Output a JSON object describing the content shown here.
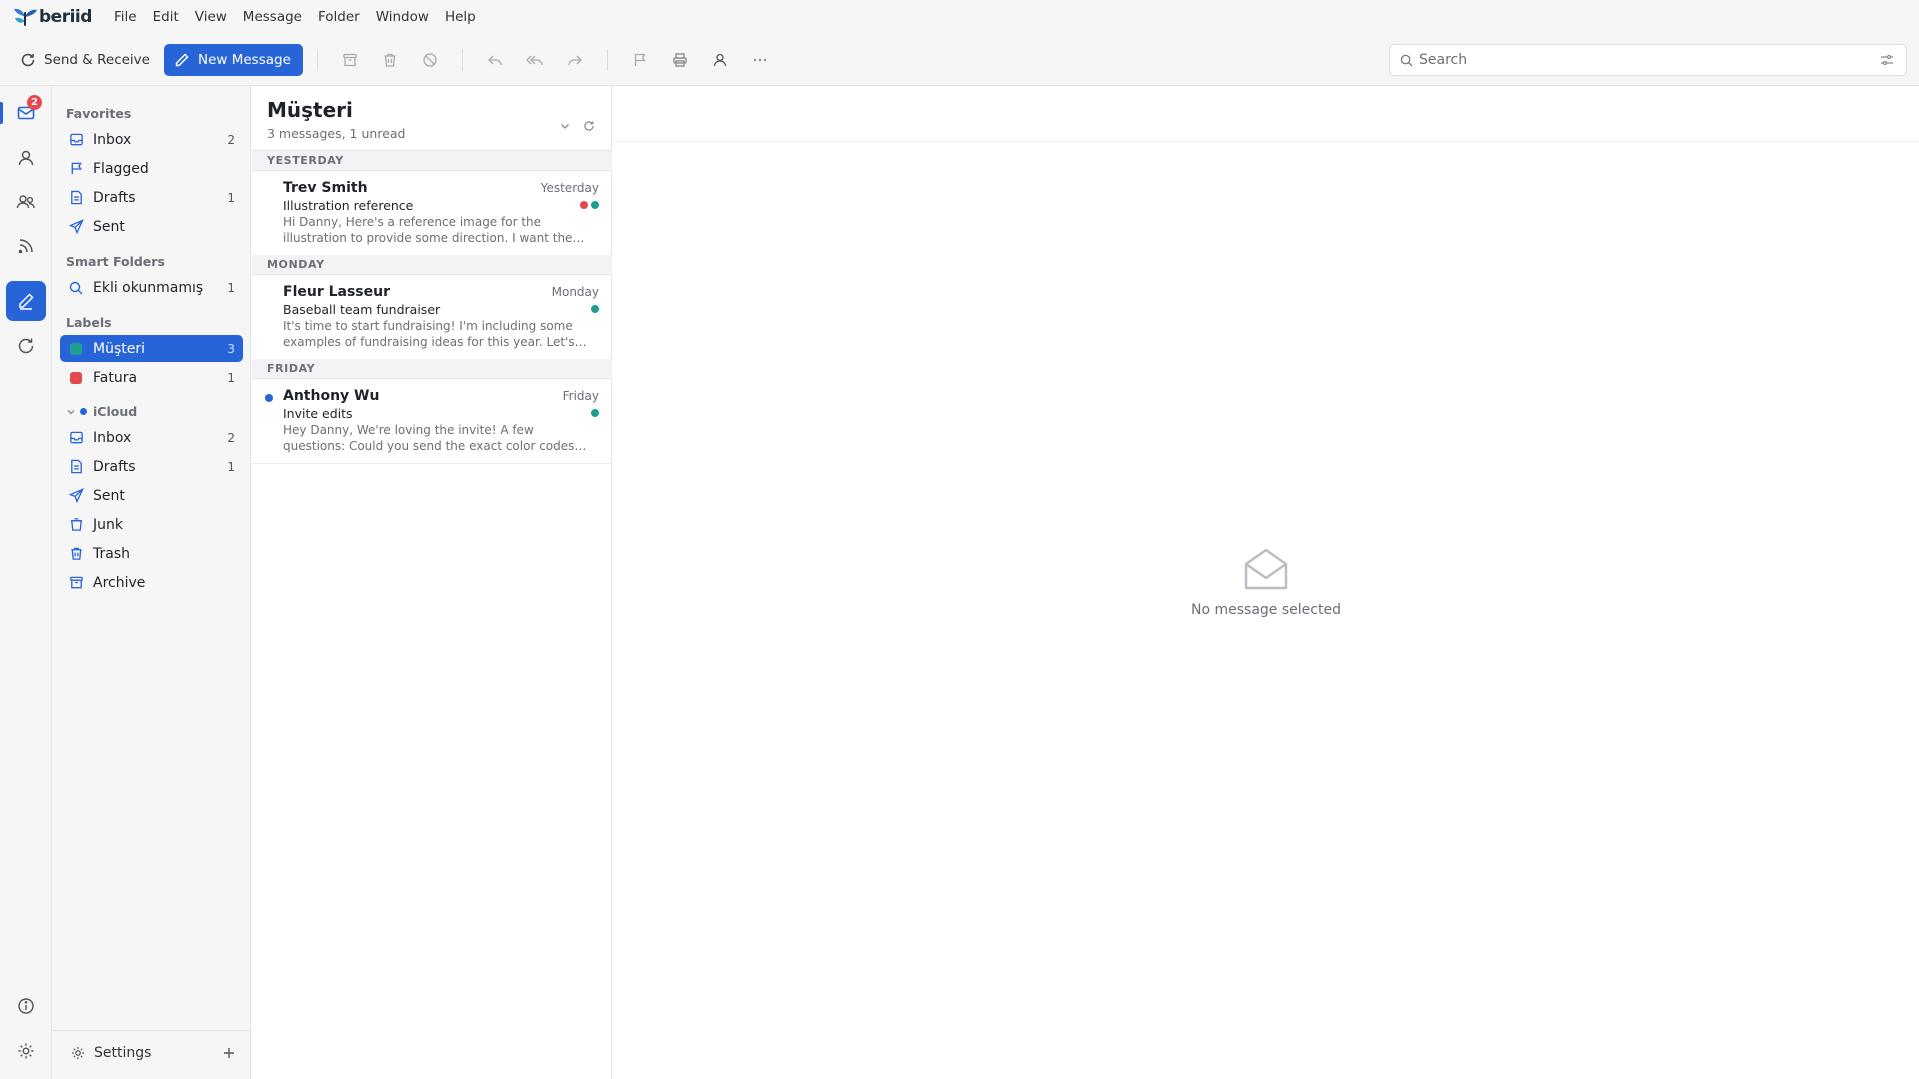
{
  "app": {
    "logo_text": "beriid",
    "menu": [
      "File",
      "Edit",
      "View",
      "Message",
      "Folder",
      "Window",
      "Help"
    ]
  },
  "toolbar": {
    "send_receive_label": "Send & Receive",
    "new_message_label": "New Message",
    "icons": [
      "archive-icon",
      "trash-icon",
      "block-icon",
      "reply-icon",
      "reply-all-icon",
      "forward-icon",
      "flag-icon",
      "print-icon",
      "contact-icon",
      "more-icon"
    ],
    "search_placeholder": "Search"
  },
  "rail": {
    "mail_badge": "2",
    "icons": [
      "mail-icon",
      "contacts-icon",
      "groups-icon",
      "rss-icon",
      "compose-icon",
      "sync-icon",
      "info-icon",
      "gear-icon"
    ]
  },
  "sidebar": {
    "favorites_heading": "Favorites",
    "favorites": [
      {
        "name": "Inbox",
        "count": "2",
        "icon": "inbox-icon"
      },
      {
        "name": "Flagged",
        "count": "",
        "icon": "flag-icon"
      },
      {
        "name": "Drafts",
        "count": "1",
        "icon": "drafts-icon"
      },
      {
        "name": "Sent",
        "count": "",
        "icon": "sent-icon"
      }
    ],
    "smart_heading": "Smart Folders",
    "smart": [
      {
        "name": "Ekli okunmamış",
        "count": "1",
        "icon": "search-icon"
      }
    ],
    "labels_heading": "Labels",
    "labels": [
      {
        "name": "Müşteri",
        "count": "3",
        "color": "#1f9d8f",
        "selected": true
      },
      {
        "name": "Fatura",
        "count": "1",
        "color": "#e5484d",
        "selected": false
      }
    ],
    "account_heading": "iCloud",
    "account_color": "#2764d8",
    "account": [
      {
        "name": "Inbox",
        "count": "2",
        "icon": "inbox-icon"
      },
      {
        "name": "Drafts",
        "count": "1",
        "icon": "drafts-icon"
      },
      {
        "name": "Sent",
        "count": "",
        "icon": "sent-icon"
      },
      {
        "name": "Junk",
        "count": "",
        "icon": "junk-icon"
      },
      {
        "name": "Trash",
        "count": "",
        "icon": "trash-icon"
      },
      {
        "name": "Archive",
        "count": "",
        "icon": "archive-icon"
      }
    ],
    "settings_label": "Settings"
  },
  "message_list": {
    "title": "Müşteri",
    "subtitle": "3 messages, 1 unread",
    "groups": [
      {
        "day": "YESTERDAY",
        "messages": [
          {
            "from": "Trev Smith",
            "date": "Yesterday",
            "subject": "Illustration reference",
            "preview": "Hi Danny, Here's a reference image for the illustration to provide some direction. I want the…",
            "tags": [
              "#e5484d",
              "#1f9d8f"
            ],
            "unread": false
          }
        ]
      },
      {
        "day": "MONDAY",
        "messages": [
          {
            "from": "Fleur Lasseur",
            "date": "Monday",
            "subject": "Baseball team fundraiser",
            "preview": "It's time to start fundraising! I'm including some examples of fundraising ideas for this year. Let's…",
            "tags": [
              "#1f9d8f"
            ],
            "unread": false
          }
        ]
      },
      {
        "day": "FRIDAY",
        "messages": [
          {
            "from": "Anthony Wu",
            "date": "Friday",
            "subject": "Invite edits",
            "preview": "Hey Danny, We're loving the invite! A few questions: Could you send the exact color codes…",
            "tags": [
              "#1f9d8f"
            ],
            "unread": true
          }
        ]
      }
    ]
  },
  "reader": {
    "empty_text": "No message selected"
  },
  "colors": {
    "accent": "#2764d8",
    "teal_label": "#1f9d8f",
    "red_label": "#e5484d"
  }
}
